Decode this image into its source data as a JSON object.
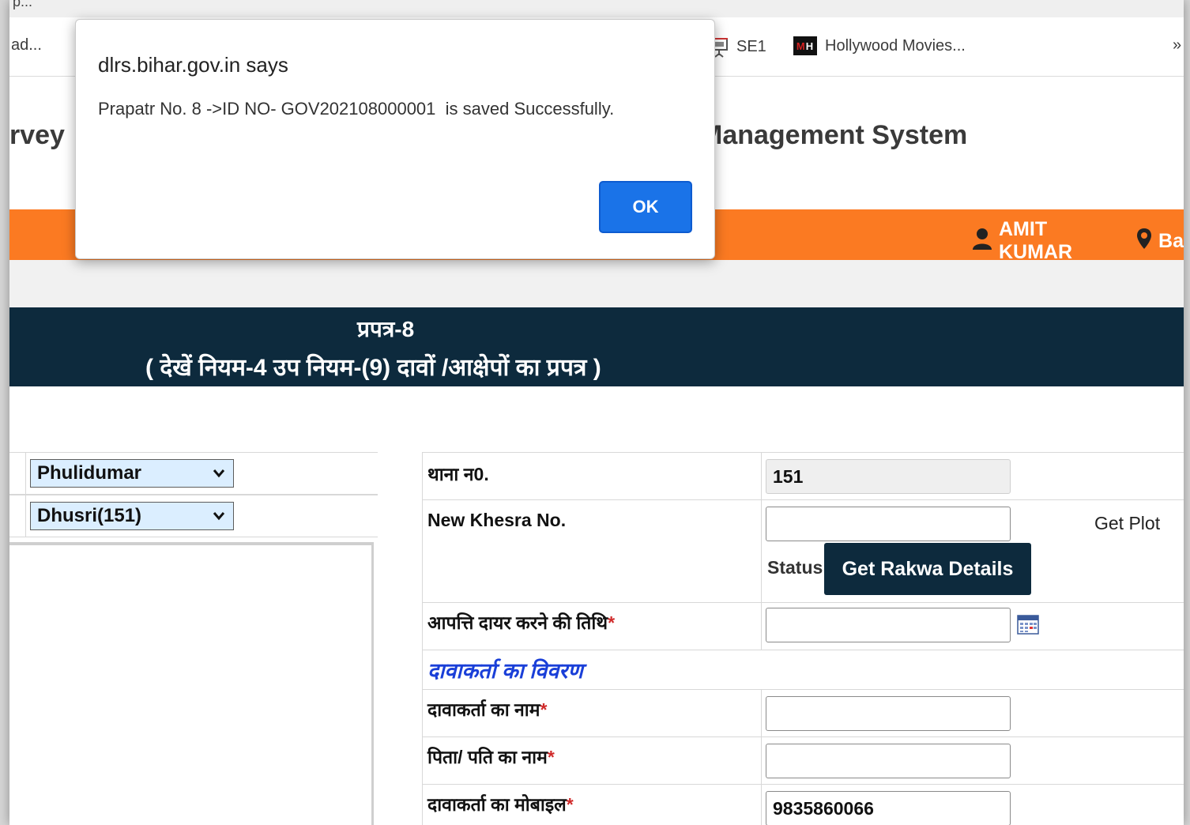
{
  "browser": {
    "url_fragment": "p...",
    "bookmarks": [
      {
        "label": "ad..."
      },
      {
        "label": "SE1",
        "icon": "presentation-icon"
      },
      {
        "label": "Hollywood Movies...",
        "icon": "mh-logo-icon"
      }
    ],
    "overflow_label": "»"
  },
  "header": {
    "title_left": "rvey",
    "title_right": "Management System",
    "user_name": "AMIT KUMAR",
    "location_partial": "Ba"
  },
  "form_header": {
    "title": "प्रपत्र-8",
    "subtitle": "( देखें नियम-4 उप नियम-(9) दावों /आक्षेपों का प्रपत्र )"
  },
  "left_panel": {
    "select1": "Phulidumar",
    "select2": "Dhusri(151)"
  },
  "form": {
    "thana_label": "थाना न0.",
    "thana_value": "151",
    "khesra_label": "New Khesra No.",
    "khesra_value": "",
    "get_plot_label": "Get Plot",
    "status_label": "Status",
    "rakwa_button": "Get Rakwa Details",
    "date_label": "आपत्ति दायर करने की तिथि",
    "claimant_section": "दावाकर्ता का विवरण",
    "name_label": "दावाकर्ता का नाम",
    "father_label": "पिता/ पति का नाम",
    "mobile_label": "दावाकर्ता का मोबाइल",
    "mobile_value": "9835860066",
    "required_mark": "*"
  },
  "dialog": {
    "title": "dlrs.bihar.gov.in says",
    "message": "Prapatr No. 8 ->ID NO- GOV202108000001  is saved Successfully.",
    "ok_label": "OK"
  },
  "colors": {
    "orange": "#fb7a22",
    "dark_navy": "#0d2a3d",
    "ok_blue": "#1a73e8",
    "select_bg": "#dbeeff"
  }
}
